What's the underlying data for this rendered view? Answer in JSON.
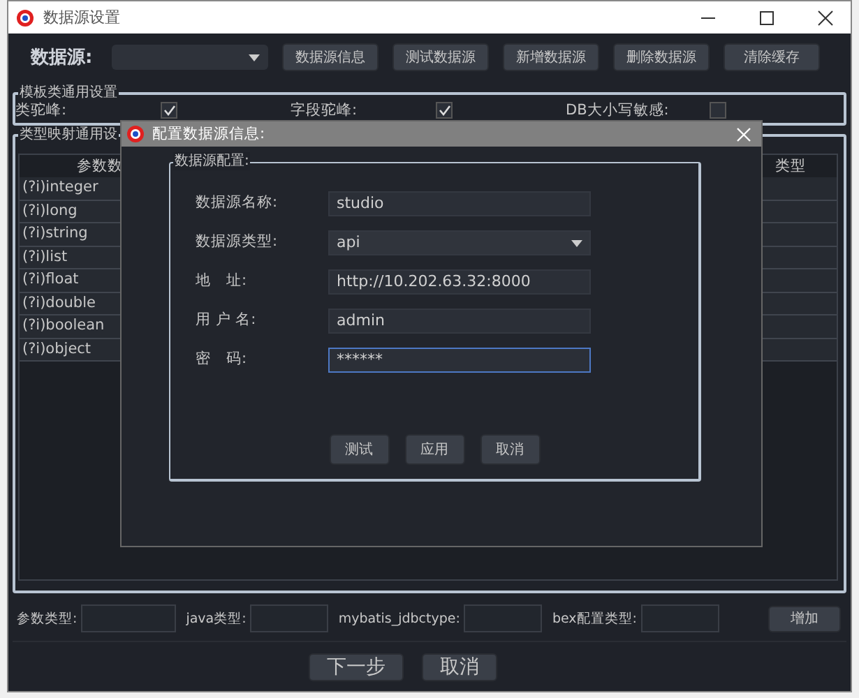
{
  "window": {
    "title": "数据源设置"
  },
  "toolbar": {
    "label": "数据源:",
    "buttons": [
      "数据源信息",
      "测试数据源",
      "新增数据源",
      "删除数据源",
      "清除缓存"
    ]
  },
  "template_settings": {
    "title": "模板类通用设置",
    "options": [
      {
        "label": "类驼峰:",
        "checked": true
      },
      {
        "label": "字段驼峰:",
        "checked": true
      },
      {
        "label": "DB大小写敏感:",
        "checked": false
      }
    ]
  },
  "type_mapping": {
    "title": "类型映射通用设",
    "columns": [
      "参数数",
      "类型"
    ],
    "rows": [
      {
        "column_1": "(?i)integer"
      },
      {
        "column_1": "(?i)long"
      },
      {
        "column_1": "(?i)string"
      },
      {
        "column_1": "(?i)list"
      },
      {
        "column_1": "(?i)float"
      },
      {
        "column_1": "(?i)double"
      },
      {
        "column_1": "(?i)boolean"
      },
      {
        "column_1": "(?i)object"
      }
    ]
  },
  "add_row": {
    "fields": [
      {
        "label": "参数类型:"
      },
      {
        "label": "java类型:"
      },
      {
        "label": "mybatis_jdbctype:"
      },
      {
        "label": "bex配置类型:"
      }
    ],
    "button": "增加"
  },
  "footer_buttons": [
    "下一步",
    "取消"
  ],
  "dialog": {
    "title": "配置数据源信息:",
    "group_title": "数据源配置:",
    "fields": [
      {
        "label": "数据源名称:",
        "value": "studio",
        "kind": "text",
        "focused": false
      },
      {
        "label": "数据源类型:",
        "value": "api",
        "kind": "select",
        "focused": false
      },
      {
        "label": "地　址:",
        "value": "http://10.202.63.32:8000",
        "kind": "text",
        "focused": false
      },
      {
        "label": "用 户 名:",
        "value": "admin",
        "kind": "text",
        "focused": false
      },
      {
        "label": "密　码:",
        "value": "******",
        "kind": "text",
        "focused": true
      }
    ],
    "buttons": [
      "测试",
      "应用",
      "取消"
    ]
  }
}
